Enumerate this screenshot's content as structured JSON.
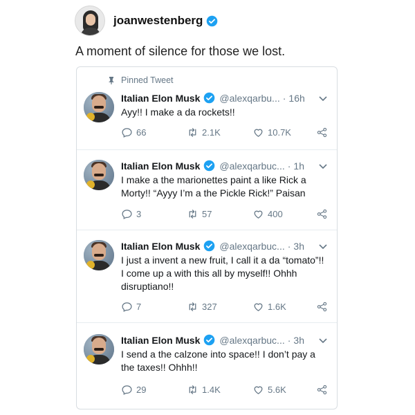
{
  "post": {
    "username": "joanwestenberg",
    "caption": "A moment of silence for those we lost."
  },
  "colors": {
    "verified": "#1da1f2",
    "muted": "#657786",
    "border": "#e6ecf0"
  },
  "pinned_label": "Pinned Tweet",
  "tweets": [
    {
      "name": "Italian Elon Musk",
      "handle": "@alexqarbu...",
      "time": "16h",
      "text": "Ayy!! I make a da rockets!!",
      "replies": "66",
      "retweets": "2.1K",
      "likes": "10.7K"
    },
    {
      "name": "Italian Elon Musk",
      "handle": "@alexqarbuc...",
      "time": "1h",
      "text": "I make a the marionettes paint a like Rick a Morty!! “Ayyy I’m a the Pickle Rick!” Paisan",
      "replies": "3",
      "retweets": "57",
      "likes": "400"
    },
    {
      "name": "Italian Elon Musk",
      "handle": "@alexqarbuc...",
      "time": "3h",
      "text": "I just a invent a new fruit, I call it a da “tomato”!! I come up a with this all by myself!! Ohhh disruptiano!!",
      "replies": "7",
      "retweets": "327",
      "likes": "1.6K"
    },
    {
      "name": "Italian Elon Musk",
      "handle": "@alexqarbuc...",
      "time": "3h",
      "text": "I send a the calzone into space!! I don’t pay a the taxes!! Ohhh!!",
      "replies": "29",
      "retweets": "1.4K",
      "likes": "5.6K"
    }
  ]
}
